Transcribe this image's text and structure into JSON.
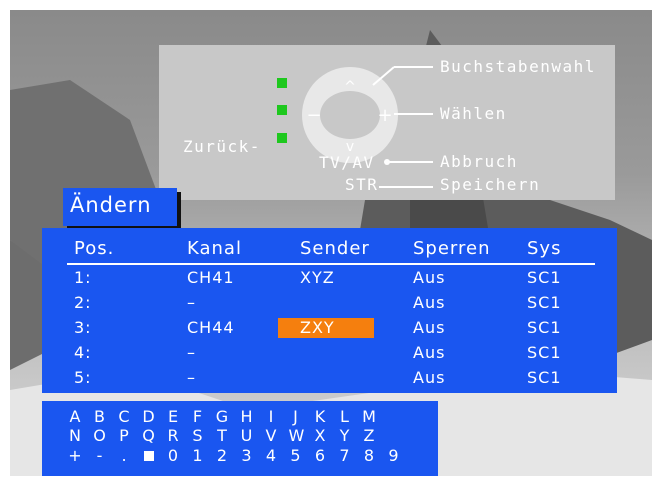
{
  "help": {
    "letter_select": "Buchstabenwahl",
    "select": "Wählen",
    "back": "Zurück-",
    "tv_av": "TV/AV",
    "cancel": "Abbruch",
    "str": "STR",
    "save": "Speichern",
    "up": "^",
    "down": "v",
    "left": "−",
    "right": "+"
  },
  "dialog": {
    "title": "Ändern"
  },
  "table": {
    "headers": [
      "Pos.",
      "Kanal",
      "Sender",
      "Sperren",
      "Sys"
    ],
    "rows": [
      [
        "1:",
        "CH41",
        "XYZ",
        "Aus",
        "SC1"
      ],
      [
        "2:",
        "–",
        "",
        "Aus",
        "SC1"
      ],
      [
        "3:",
        "CH44",
        "ZXY",
        "Aus",
        "SC1"
      ],
      [
        "4:",
        "–",
        "",
        "Aus",
        "SC1"
      ],
      [
        "5:",
        "–",
        "",
        "Aus",
        "SC1"
      ]
    ]
  },
  "keyboard": {
    "rows": [
      [
        "A",
        "B",
        "C",
        "D",
        "E",
        "F",
        "G",
        "H",
        "I",
        "J",
        "K",
        "L",
        "M"
      ],
      [
        "N",
        "O",
        "P",
        "Q",
        "R",
        "S",
        "T",
        "U",
        "V",
        "W",
        "X",
        "Y",
        "Z"
      ],
      [
        "+",
        "-",
        ".",
        "",
        "0",
        "1",
        "2",
        "3",
        "4",
        "5",
        "6",
        "7",
        "8",
        "9"
      ]
    ]
  },
  "colors": {
    "panel": "#1a56f0",
    "highlight": "#f57f0e",
    "indicator": "#1ec81e"
  }
}
